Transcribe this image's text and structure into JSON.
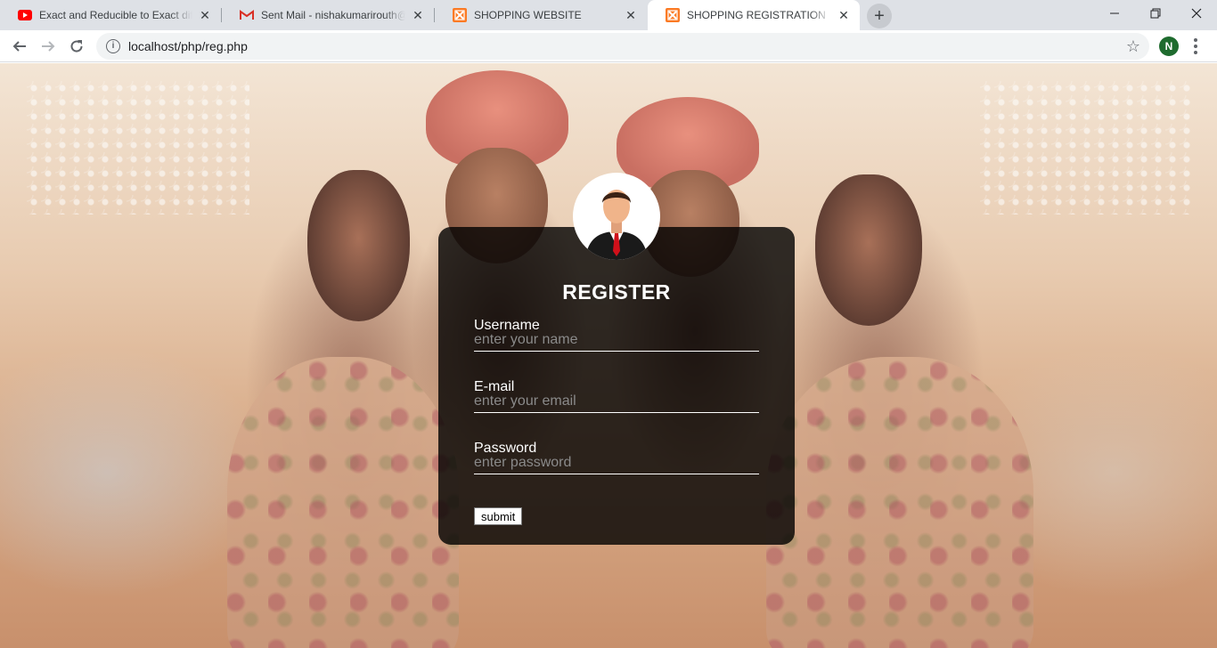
{
  "browser": {
    "tabs": [
      {
        "title": "Exact and Reducible to Exact diffe",
        "favicon": "youtube-icon",
        "favicon_color": "#ff0000",
        "active": false
      },
      {
        "title": "Sent Mail - nishakumarirouth@gm",
        "favicon": "gmail-icon",
        "favicon_color": "#d93025",
        "active": false
      },
      {
        "title": "SHOPPING WEBSITE",
        "favicon": "xampp-icon",
        "favicon_color": "#fb7a24",
        "active": false
      },
      {
        "title": "SHOPPING REGISTRATION",
        "favicon": "xampp-icon",
        "favicon_color": "#fb7a24",
        "active": true
      }
    ],
    "close_glyph": "✕",
    "new_tab_glyph": "+",
    "address": {
      "url": "localhost/php/reg.php",
      "info_glyph": "i"
    },
    "profile_initial": "N"
  },
  "form": {
    "title": "REGISTER",
    "fields": [
      {
        "label": "Username",
        "placeholder": "enter your name",
        "name": "username"
      },
      {
        "label": "E-mail",
        "placeholder": "enter your email",
        "name": "email"
      },
      {
        "label": "Password",
        "placeholder": "enter password",
        "name": "password"
      }
    ],
    "submit_label": "submit"
  },
  "colors": {
    "card_bg": "rgba(0,0,0,0.8)",
    "tabstrip": "#dee1e6",
    "profile_bg": "#1e6b2e"
  }
}
